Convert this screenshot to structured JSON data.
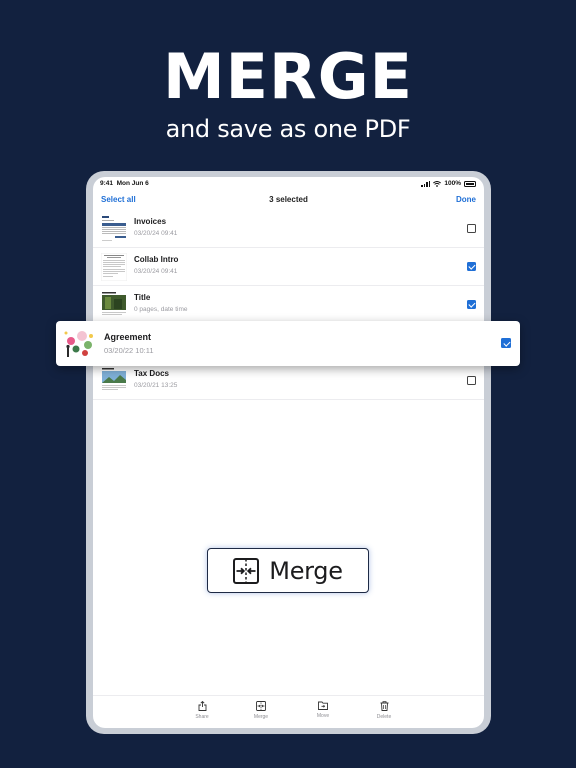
{
  "promo": {
    "headline": "MERGE",
    "subhead": "and save as one PDF"
  },
  "status_bar": {
    "time": "9:41",
    "date": "Mon Jun 6",
    "battery": "100%"
  },
  "nav": {
    "select_all": "Select all",
    "selection_count": "3 selected",
    "done": "Done"
  },
  "files": [
    {
      "name": "Invoices",
      "meta": "03/20/24 09:41",
      "selected": false,
      "thumb": "invoice-thumbnail"
    },
    {
      "name": "Collab Intro",
      "meta": "03/20/24 09:41",
      "selected": true,
      "thumb": "letter-thumbnail"
    },
    {
      "name": "Title",
      "meta": "0 pages, date time",
      "selected": true,
      "thumb": "photo-thumbnail"
    },
    {
      "name": "Agreement",
      "meta": "03/20/22 10:11",
      "selected": true,
      "thumb": "illustration-thumbnail",
      "dragging": true
    },
    {
      "name": "Tax Docs",
      "meta": "03/20/21 13:25",
      "selected": false,
      "thumb": "landscape-thumbnail"
    }
  ],
  "merge_button": {
    "label": "Merge",
    "icon": "merge-icon"
  },
  "toolbar": {
    "share": "Share",
    "merge": "Merge",
    "move": "Move",
    "delete": "Delete"
  },
  "colors": {
    "background": "#12213f",
    "accent": "#1f6fd6",
    "checkbox_selected": "#1f6fd6"
  }
}
